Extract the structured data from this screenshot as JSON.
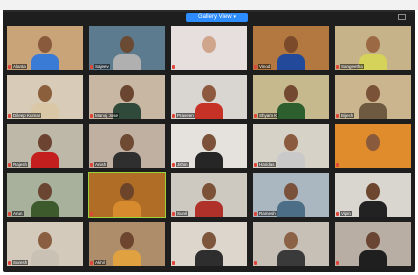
{
  "toolbar": {
    "view_label": "Gallery View",
    "view_chevron": "▾",
    "fullscreen_icon": "fullscreen-icon"
  },
  "participants": [
    {
      "name": "Alanta",
      "bg": "#c9a479",
      "skin": "#8a5a3c",
      "shirt": "#3a7bd5"
    },
    {
      "name": "Sajeev",
      "bg": "#5d7b8f",
      "skin": "#6b4a33",
      "shirt": "#b0b0b0"
    },
    {
      "name": "",
      "bg": "#e7dede",
      "skin": "#cfa58c",
      "shirt": "#e7dede"
    },
    {
      "name": "Vinod",
      "bg": "#b3783f",
      "skin": "#7a4a2b",
      "shirt": "#234a9a"
    },
    {
      "name": "Sangeetha",
      "bg": "#c6b38a",
      "skin": "#9b6a45",
      "shirt": "#d6d35a"
    },
    {
      "name": "Dileep Kumar",
      "bg": "#d8cbb7",
      "skin": "#8b5e3c",
      "shirt": "#d9c7a6"
    },
    {
      "name": "Manoj Jose",
      "bg": "#c8b7a3",
      "skin": "#6a4631",
      "shirt": "#2f4a3a"
    },
    {
      "name": "Praveen",
      "bg": "#d9d5d1",
      "skin": "#8e5a3f",
      "shirt": "#c73226"
    },
    {
      "name": "Shyam K",
      "bg": "#c7b98e",
      "skin": "#734a31",
      "shirt": "#2d5e2e"
    },
    {
      "name": "Bijesh",
      "bg": "#cbb58e",
      "skin": "#7a5237",
      "shirt": "#6d5a41"
    },
    {
      "name": "Rajesh",
      "bg": "#bdb8a8",
      "skin": "#6b4330",
      "shirt": "#c41f1f"
    },
    {
      "name": "Anish",
      "bg": "#bfb0a2",
      "skin": "#6e4a33",
      "shirt": "#2f2f2f"
    },
    {
      "name": "Jithin",
      "bg": "#e5e2de",
      "skin": "#7c523a",
      "shirt": "#262626"
    },
    {
      "name": "Haridas",
      "bg": "#d7d2c8",
      "skin": "#8a5b3f",
      "shirt": "#c9c9c9"
    },
    {
      "name": "",
      "bg": "#e08c2c",
      "skin": "#8a5a3c",
      "shirt": "#e08c2c"
    },
    {
      "name": "Arun",
      "bg": "#a7b19c",
      "skin": "#6a4532",
      "shirt": "#3c5a2c"
    },
    {
      "name": "",
      "bg": "#b06d25",
      "skin": "#6b4429",
      "shirt": "#d88a2e"
    },
    {
      "name": "Sunil",
      "bg": "#cec9c0",
      "skin": "#7b5238",
      "shirt": "#b0302a"
    },
    {
      "name": "Ramesh",
      "bg": "#aab7c0",
      "skin": "#7a523b",
      "shirt": "#4d6e87"
    },
    {
      "name": "Vipin",
      "bg": "#d9d6d0",
      "skin": "#6d4630",
      "shirt": "#222222"
    },
    {
      "name": "Suresh",
      "bg": "#d4cabb",
      "skin": "#8a5e41",
      "shirt": "#c9c1b4"
    },
    {
      "name": "Akhil",
      "bg": "#ad8d6a",
      "skin": "#6e4630",
      "shirt": "#e0a240"
    },
    {
      "name": "",
      "bg": "#dcd6cc",
      "skin": "#7d563c",
      "shirt": "#2e2e2e"
    },
    {
      "name": "",
      "bg": "#c7c0b6",
      "skin": "#8c6247",
      "shirt": "#3a3a3a"
    },
    {
      "name": "",
      "bg": "#b8aea3",
      "skin": "#6a4533",
      "shirt": "#1f1f1f"
    }
  ]
}
